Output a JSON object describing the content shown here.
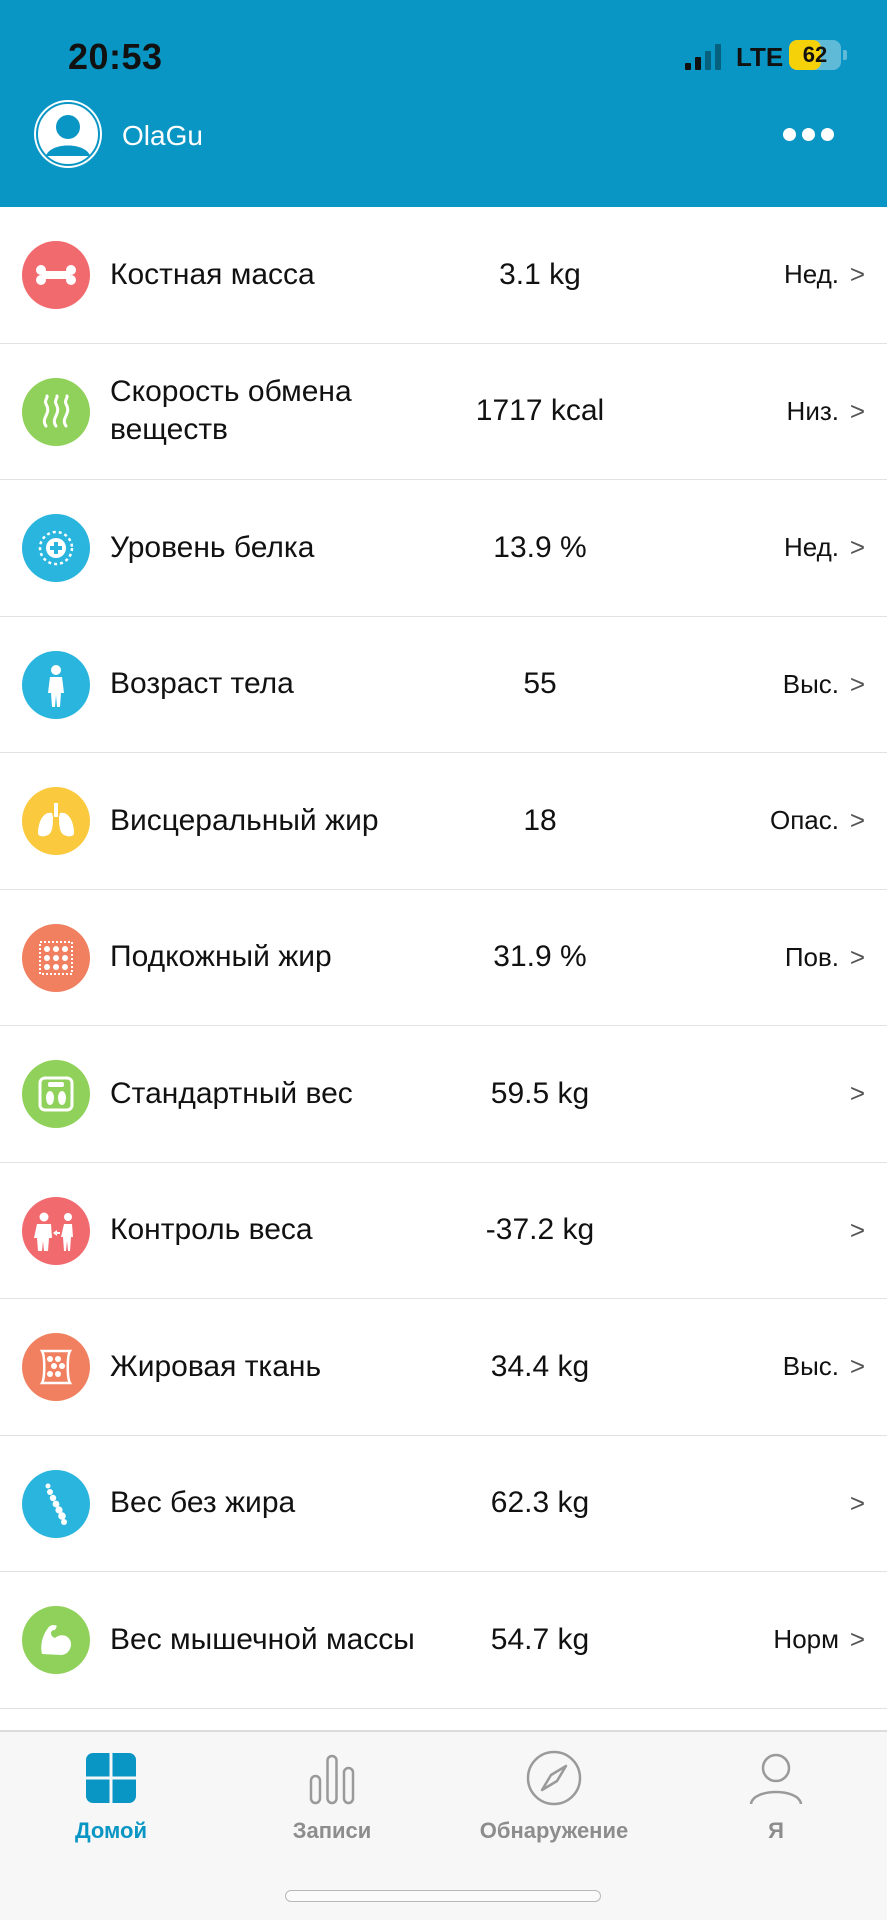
{
  "status_bar": {
    "time": "20:53",
    "network": "LTE",
    "battery": "62",
    "battery_level": 0.62
  },
  "header": {
    "username": "OlaGu"
  },
  "metrics": [
    {
      "label": "Костная масса",
      "value": "3.1 kg",
      "status": "Нед.",
      "icon": "bone-icon",
      "color": "#f06a6e"
    },
    {
      "label": "Скорость обмена веществ",
      "value": "1717 kcal",
      "status": "Низ.",
      "icon": "metabolism-waves-icon",
      "color": "#8fd15a"
    },
    {
      "label": "Уровень белка",
      "value": "13.9 %",
      "status": "Нед.",
      "icon": "protein-icon",
      "color": "#29b5dd"
    },
    {
      "label": "Возраст тела",
      "value": "55",
      "status": "Выс.",
      "icon": "body-figure-icon",
      "color": "#29b5dd"
    },
    {
      "label": "Висцеральный жир",
      "value": "18",
      "status": "Опас.",
      "icon": "lungs-icon",
      "color": "#fbc93e"
    },
    {
      "label": "Подкожный жир",
      "value": "31.9 %",
      "status": "Пов.",
      "icon": "fat-cells-icon",
      "color": "#f0805f"
    },
    {
      "label": "Стандартный вес",
      "value": "59.5 kg",
      "status": "",
      "icon": "scale-icon",
      "color": "#8fd15a"
    },
    {
      "label": "Контроль веса",
      "value": "-37.2 kg",
      "status": "",
      "icon": "weight-control-icon",
      "color": "#f06a6e"
    },
    {
      "label": "Жировая ткань",
      "value": "34.4 kg",
      "status": "Выс.",
      "icon": "fat-tissue-icon",
      "color": "#f0805f"
    },
    {
      "label": "Вес без жира",
      "value": "62.3 kg",
      "status": "",
      "icon": "spine-icon",
      "color": "#29b5dd"
    },
    {
      "label": "Вес мышечной массы",
      "value": "54.7 kg",
      "status": "Норм",
      "icon": "muscle-arm-icon",
      "color": "#8fd15a"
    }
  ],
  "chevron": ">",
  "tabs": [
    {
      "label": "Домой",
      "icon": "home-grid-icon",
      "active": true
    },
    {
      "label": "Записи",
      "icon": "bars-icon",
      "active": false
    },
    {
      "label": "Обнаружение",
      "icon": "compass-icon",
      "active": false
    },
    {
      "label": "Я",
      "icon": "person-icon",
      "active": false
    }
  ],
  "colors": {
    "header": "#0a96c4",
    "accent": "#0a96c4",
    "tab_inactive": "#8d8d8d"
  }
}
